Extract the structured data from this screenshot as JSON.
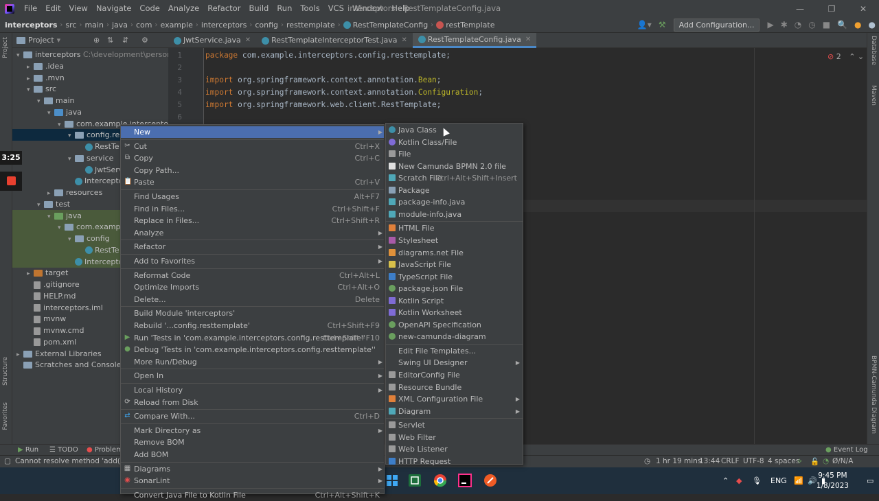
{
  "menubar": {
    "items": [
      "File",
      "Edit",
      "View",
      "Navigate",
      "Code",
      "Analyze",
      "Refactor",
      "Build",
      "Run",
      "Tools",
      "VCS",
      "Window",
      "Help"
    ],
    "window_title": "interceptors - RestTemplateConfig.java"
  },
  "breadcrumbs": [
    "interceptors",
    "src",
    "main",
    "java",
    "com",
    "example",
    "interceptors",
    "config",
    "resttemplate",
    "RestTemplateConfig",
    "restTemplate"
  ],
  "toolbar": {
    "add_config": "Add Configuration..."
  },
  "project": {
    "header": "Project",
    "tree": [
      {
        "label": "interceptors",
        "path": "C:\\development\\personal\\you",
        "indent": 0,
        "arrow": "▾",
        "icon": "folder"
      },
      {
        "label": ".idea",
        "indent": 1,
        "arrow": "▸",
        "icon": "folder"
      },
      {
        "label": ".mvn",
        "indent": 1,
        "arrow": "▸",
        "icon": "folder"
      },
      {
        "label": "src",
        "indent": 1,
        "arrow": "▾",
        "icon": "folder"
      },
      {
        "label": "main",
        "indent": 2,
        "arrow": "▾",
        "icon": "folder"
      },
      {
        "label": "java",
        "indent": 3,
        "arrow": "▾",
        "icon": "folder-blue"
      },
      {
        "label": "com.example.interceptors",
        "indent": 4,
        "arrow": "▾",
        "icon": "folder"
      },
      {
        "label": "config.rest",
        "indent": 5,
        "arrow": "▾",
        "icon": "folder",
        "selected": true
      },
      {
        "label": "RestTe",
        "indent": 6,
        "arrow": "",
        "icon": "class"
      },
      {
        "label": "service",
        "indent": 5,
        "arrow": "▾",
        "icon": "folder"
      },
      {
        "label": "JwtServ",
        "indent": 6,
        "arrow": "",
        "icon": "class"
      },
      {
        "label": "Intercepto",
        "indent": 5,
        "arrow": "",
        "icon": "class"
      },
      {
        "label": "resources",
        "indent": 3,
        "arrow": "▸",
        "icon": "folder"
      },
      {
        "label": "test",
        "indent": 2,
        "arrow": "▾",
        "icon": "folder"
      },
      {
        "label": "java",
        "indent": 3,
        "arrow": "▾",
        "icon": "folder-green",
        "hl": true
      },
      {
        "label": "com.example.",
        "indent": 4,
        "arrow": "▾",
        "icon": "folder",
        "hl": true
      },
      {
        "label": "config",
        "indent": 5,
        "arrow": "▾",
        "icon": "folder",
        "hl": true
      },
      {
        "label": "RestTe",
        "indent": 6,
        "arrow": "",
        "icon": "class",
        "hl": true
      },
      {
        "label": "Intercepto",
        "indent": 5,
        "arrow": "",
        "icon": "class",
        "hl": true
      },
      {
        "label": "target",
        "indent": 1,
        "arrow": "▸",
        "icon": "folder-orange"
      },
      {
        "label": ".gitignore",
        "indent": 1,
        "arrow": "",
        "icon": "file"
      },
      {
        "label": "HELP.md",
        "indent": 1,
        "arrow": "",
        "icon": "file"
      },
      {
        "label": "interceptors.iml",
        "indent": 1,
        "arrow": "",
        "icon": "file"
      },
      {
        "label": "mvnw",
        "indent": 1,
        "arrow": "",
        "icon": "file"
      },
      {
        "label": "mvnw.cmd",
        "indent": 1,
        "arrow": "",
        "icon": "file"
      },
      {
        "label": "pom.xml",
        "indent": 1,
        "arrow": "",
        "icon": "file"
      },
      {
        "label": "External Libraries",
        "indent": 0,
        "arrow": "▸",
        "icon": "folder"
      },
      {
        "label": "Scratches and Consoles",
        "indent": 0,
        "arrow": "",
        "icon": "folder"
      }
    ]
  },
  "tabs": [
    "JwtService.java",
    "RestTemplateInterceptorTest.java",
    "RestTemplateConfig.java"
  ],
  "editor": {
    "line_numbers": [
      "1",
      "2",
      "3",
      "4",
      "5",
      "6"
    ],
    "lines": [
      {
        "kw": "package",
        "rest": " com.example.interceptors.config.resttemplate;"
      },
      {
        "kw": "",
        "rest": ""
      },
      {
        "kw": "import",
        "rest": " org.springframework.context.annotation.",
        "an": "Bean",
        ";": ";"
      },
      {
        "kw": "import",
        "rest": " org.springframework.context.annotation.",
        "an": "Configuration",
        ";": ";"
      },
      {
        "kw": "import",
        "rest": " org.springframework.web.client.RestTemplate;"
      },
      {
        "kw": "",
        "rest": ""
      }
    ],
    "error_count": "2"
  },
  "overlay": {
    "timer": "3:25"
  },
  "left_strip": {
    "project": "Project",
    "structure": "Structure",
    "favorites": "Favorites"
  },
  "right_strip": {
    "database": "Database",
    "maven": "Maven",
    "bpmn": "BPMN-Camunda Diagram"
  },
  "context_menu": [
    {
      "label": "New",
      "sub": true,
      "active": true
    },
    {
      "sep": true
    },
    {
      "label": "Cut",
      "shortcut": "Ctrl+X",
      "icon": "✂"
    },
    {
      "label": "Copy",
      "shortcut": "Ctrl+C",
      "icon": "⧉"
    },
    {
      "label": "Copy Path..."
    },
    {
      "label": "Paste",
      "shortcut": "Ctrl+V",
      "icon": "📋"
    },
    {
      "sep": true
    },
    {
      "label": "Find Usages",
      "shortcut": "Alt+F7"
    },
    {
      "label": "Find in Files...",
      "shortcut": "Ctrl+Shift+F"
    },
    {
      "label": "Replace in Files...",
      "shortcut": "Ctrl+Shift+R"
    },
    {
      "label": "Analyze",
      "sub": true
    },
    {
      "sep": true
    },
    {
      "label": "Refactor",
      "sub": true
    },
    {
      "sep": true
    },
    {
      "label": "Add to Favorites",
      "sub": true
    },
    {
      "sep": true
    },
    {
      "label": "Reformat Code",
      "shortcut": "Ctrl+Alt+L"
    },
    {
      "label": "Optimize Imports",
      "shortcut": "Ctrl+Alt+O"
    },
    {
      "label": "Delete...",
      "shortcut": "Delete"
    },
    {
      "sep": true
    },
    {
      "label": "Build Module 'interceptors'"
    },
    {
      "label": "Rebuild '...config.resttemplate'",
      "shortcut": "Ctrl+Shift+F9"
    },
    {
      "label": "Run 'Tests in 'com.example.interceptors.config.resttemplate''",
      "shortcut": "Ctrl+Shift+F10",
      "icon": "▶"
    },
    {
      "label": "Debug 'Tests in 'com.example.interceptors.config.resttemplate''",
      "icon": "●"
    },
    {
      "label": "More Run/Debug",
      "sub": true
    },
    {
      "sep": true
    },
    {
      "label": "Open In",
      "sub": true
    },
    {
      "sep": true
    },
    {
      "label": "Local History",
      "sub": true
    },
    {
      "label": "Reload from Disk",
      "icon": "⟳"
    },
    {
      "sep": true
    },
    {
      "label": "Compare With...",
      "shortcut": "Ctrl+D",
      "icon": "⇄"
    },
    {
      "sep": true
    },
    {
      "label": "Mark Directory as",
      "sub": true
    },
    {
      "label": "Remove BOM"
    },
    {
      "label": "Add BOM"
    },
    {
      "sep": true
    },
    {
      "label": "Diagrams",
      "sub": true,
      "icon": "▦"
    },
    {
      "label": "SonarLint",
      "sub": true,
      "icon": "◉"
    },
    {
      "sep": true
    },
    {
      "label": "Convert Java File to Kotlin File",
      "shortcut": "Ctrl+Alt+Shift+K"
    }
  ],
  "new_submenu": [
    {
      "label": "Java Class",
      "color": "#3d8fa8"
    },
    {
      "label": "Kotlin Class/File",
      "color": "#7f6bd6"
    },
    {
      "label": "File",
      "color": "#9a9a9a",
      "sq": true
    },
    {
      "label": "New Camunda BPMN 2.0 file",
      "color": "#e0e0e0",
      "sq": true
    },
    {
      "label": "Scratch File",
      "shortcut": "Ctrl+Alt+Shift+Insert",
      "color": "#4fa8b8",
      "sq": true
    },
    {
      "label": "Package",
      "color": "#8aa0b5",
      "sq": true
    },
    {
      "label": "package-info.java",
      "color": "#4fa8b8",
      "sq": true
    },
    {
      "label": "module-info.java",
      "color": "#4fa8b8",
      "sq": true
    },
    {
      "sep": true
    },
    {
      "label": "HTML File",
      "color": "#e0803a",
      "sq": true
    },
    {
      "label": "Stylesheet",
      "color": "#a85aa8",
      "sq": true
    },
    {
      "label": "diagrams.net File",
      "color": "#e0913a",
      "sq": true
    },
    {
      "label": "JavaScript File",
      "color": "#d8c04a",
      "sq": true
    },
    {
      "label": "TypeScript File",
      "color": "#3d7ec8",
      "sq": true
    },
    {
      "label": "package.json File",
      "color": "#6a9f5e"
    },
    {
      "label": "Kotlin Script",
      "color": "#7f6bd6",
      "sq": true
    },
    {
      "label": "Kotlin Worksheet",
      "color": "#7f6bd6",
      "sq": true
    },
    {
      "label": "OpenAPI Specification",
      "color": "#6a9f5e"
    },
    {
      "label": "new-camunda-diagram",
      "color": "#6a9f5e"
    },
    {
      "sep": true
    },
    {
      "label": "Edit File Templates..."
    },
    {
      "label": "Swing UI Designer",
      "sub": true
    },
    {
      "label": "EditorConfig File",
      "color": "#9a9a9a",
      "sq": true
    },
    {
      "label": "Resource Bundle",
      "color": "#9a9a9a",
      "sq": true
    },
    {
      "label": "XML Configuration File",
      "sub": true,
      "color": "#e0803a",
      "sq": true
    },
    {
      "label": "Diagram",
      "sub": true,
      "color": "#4fa8b8",
      "sq": true
    },
    {
      "sep": true
    },
    {
      "label": "Servlet",
      "color": "#9a9a9a",
      "sq": true
    },
    {
      "label": "Web Filter",
      "color": "#9a9a9a",
      "sq": true
    },
    {
      "label": "Web Listener",
      "color": "#9a9a9a",
      "sq": true
    },
    {
      "label": "HTTP Request",
      "color": "#3d7ec8",
      "sq": true
    }
  ],
  "bottom_tabs": {
    "run": "Run",
    "todo": "TODO",
    "problems": "Problems",
    "event_log": "Event Log"
  },
  "status": {
    "message": "Cannot resolve method 'add()'",
    "time": "1 hr 19 mins",
    "position": "13:44",
    "line_sep": "CRLF",
    "encoding": "UTF-8",
    "indent": "4 spaces",
    "na": "Ø/N/A"
  },
  "taskbar": {
    "lang": "ENG",
    "time": "9:45 PM",
    "date": "1/8/2023"
  }
}
